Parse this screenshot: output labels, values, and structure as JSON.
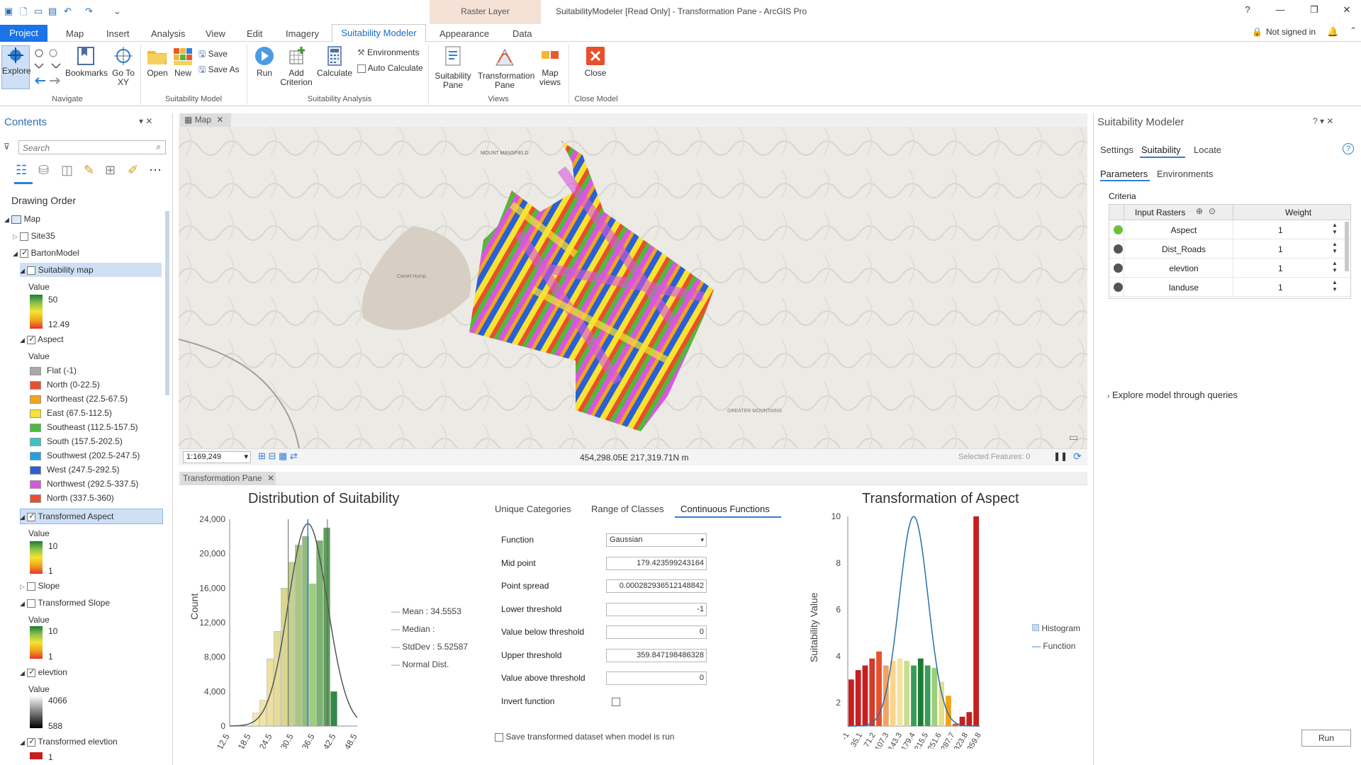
{
  "titlebar": {
    "context_tab": "Raster Layer",
    "title": "SuitabilityModeler [Read Only] - Transformation Pane - ArcGIS Pro",
    "help": "?"
  },
  "tabs": [
    "Project",
    "Map",
    "Insert",
    "Analysis",
    "View",
    "Edit",
    "Imagery",
    "Suitability Modeler",
    "Appearance",
    "Data"
  ],
  "signin": "Not signed in",
  "ribbon": {
    "navigate": {
      "explore": "Explore",
      "bookmarks": "Bookmarks",
      "goto": "Go To XY",
      "group": "Navigate"
    },
    "model": {
      "open": "Open",
      "new": "New",
      "save": "Save",
      "save_as": "Save As",
      "group": "Suitability Model"
    },
    "analysis": {
      "run": "Run",
      "add_criterion": "Add Criterion",
      "calculate": "Calculate",
      "environments": "Environments",
      "auto_calculate": "Auto Calculate",
      "group": "Suitability Analysis"
    },
    "views": {
      "suitability_pane": "Suitability Pane",
      "transformation_pane": "Transformation Pane",
      "map_views": "Map views",
      "group": "Views"
    },
    "close": {
      "close": "Close",
      "group": "Close Model"
    }
  },
  "contents": {
    "title": "Contents",
    "search_placeholder": "Search",
    "drawing_order": "Drawing Order",
    "map": "Map",
    "site": "Site35",
    "model": "BartonModel",
    "suit_map": "Suitability map",
    "value": "Value",
    "suit_high": "50",
    "suit_low": "12.49",
    "aspect": "Aspect",
    "aspect_classes": [
      {
        "label": "Flat (-1)",
        "color": "#a9a9a9"
      },
      {
        "label": "North (0-22.5)",
        "color": "#e8502c"
      },
      {
        "label": "Northeast (22.5-67.5)",
        "color": "#f0a51b"
      },
      {
        "label": "East (67.5-112.5)",
        "color": "#f7e332"
      },
      {
        "label": "Southeast (112.5-157.5)",
        "color": "#4dbb3c"
      },
      {
        "label": "South (157.5-202.5)",
        "color": "#3bc3c7"
      },
      {
        "label": "Southwest (202.5-247.5)",
        "color": "#1fa2e4"
      },
      {
        "label": "West (247.5-292.5)",
        "color": "#2a5fd6"
      },
      {
        "label": "Northwest (292.5-337.5)",
        "color": "#d957e0"
      },
      {
        "label": "North (337.5-360)",
        "color": "#e8502c"
      }
    ],
    "t_aspect": "Transformed Aspect",
    "t_aspect_high": "10",
    "t_aspect_low": "1",
    "slope": "Slope",
    "t_slope": "Transformed Slope",
    "t_slope_high": "10",
    "t_slope_low": "1",
    "elevation": "elevtion",
    "elev_high": "4066",
    "elev_low": "588",
    "t_elevation": "Transformed elevtion",
    "t_elev_low": "1"
  },
  "map": {
    "tab": "Map",
    "scale": "1:169,249",
    "coords": "454,298.05E 217,319.71N m",
    "selected": "Selected Features: 0",
    "labels": [
      "MOUNT MANSFIELD",
      "GREATER MOUNTAINS",
      "Camel Hump"
    ]
  },
  "transformation": {
    "tab": "Transformation Pane",
    "dist_title": "Distribution of Suitability",
    "dist_ylabel": "Count",
    "dist_yticks": [
      "24,000",
      "20,000",
      "16,000",
      "12,000",
      "8,000",
      "4,000",
      "0"
    ],
    "dist_xticks": [
      "12.5",
      "18.5",
      "24.5",
      "30.5",
      "36.5",
      "42.5",
      "48.5"
    ],
    "stats": {
      "mean": "Mean : 34.5553",
      "median": "Median :",
      "stddev": "StdDev : 5.52587",
      "normal": "Normal Dist."
    },
    "method_tabs": [
      "Unique Categories",
      "Range of Classes",
      "Continuous Functions"
    ],
    "fields": [
      {
        "label": "Function",
        "value": "Gaussian"
      },
      {
        "label": "Mid point",
        "value": "179.423599243164"
      },
      {
        "label": "Point spread",
        "value": "0.000282936512148842"
      },
      {
        "label": "Lower threshold",
        "value": "-1"
      },
      {
        "label": "Value below threshold",
        "value": "0"
      },
      {
        "label": "Upper threshold",
        "value": "359.847198486328"
      },
      {
        "label": "Value above threshold",
        "value": "0"
      },
      {
        "label": "Invert function",
        "value": ""
      }
    ],
    "save_checkbox": "Save transformed dataset when model is run",
    "trans_title": "Transformation of Aspect",
    "trans_ylabel": "Suitability Value",
    "trans_yticks": [
      "10",
      "8",
      "6",
      "4",
      "2"
    ],
    "trans_xticks": [
      "-1",
      "35.1",
      "71.2",
      "107.3",
      "143.3",
      "179.4",
      "215.5",
      "251.6",
      "287.7",
      "323.8",
      "359.8"
    ],
    "legend": {
      "histogram": "Histogram",
      "function": "Function"
    }
  },
  "chart_data": [
    {
      "type": "bar",
      "title": "Distribution of Suitability",
      "ylabel": "Count",
      "ylim": [
        0,
        24000
      ],
      "x": [
        20,
        22,
        24,
        26,
        28,
        30,
        32,
        34,
        36,
        38,
        40,
        42
      ],
      "values": [
        1500,
        3000,
        7800,
        11000,
        16000,
        19000,
        21000,
        22000,
        16500,
        21500,
        23000,
        4000
      ],
      "annotations": {
        "mean": 34.5553,
        "stddev": 5.52587
      }
    },
    {
      "type": "bar",
      "title": "Transformation of Aspect",
      "ylabel": "Suitability Value",
      "ylim": [
        1,
        10
      ],
      "values": [
        3.0,
        3.4,
        3.6,
        3.9,
        4.2,
        3.6,
        3.8,
        3.9,
        3.8,
        3.6,
        3.9,
        3.6,
        3.5,
        2.9,
        2.3,
        1.1,
        1.4,
        1.6,
        10.0
      ],
      "function": "Gaussian",
      "midpoint": 179.4
    }
  ],
  "right": {
    "title": "Suitability Modeler",
    "tabs": [
      "Settings",
      "Suitability",
      "Locate"
    ],
    "subtabs": [
      "Parameters",
      "Environments"
    ],
    "criteria": "Criteria",
    "col_input": "Input Rasters",
    "col_weight": "Weight",
    "rows": [
      {
        "name": "Aspect",
        "weight": "1",
        "color": "#6cc13a"
      },
      {
        "name": "Dist_Roads",
        "weight": "1",
        "color": "#555555"
      },
      {
        "name": "elevtion",
        "weight": "1",
        "color": "#555555"
      },
      {
        "name": "landuse",
        "weight": "1",
        "color": "#555555"
      }
    ],
    "explore": "Explore model through queries",
    "run": "Run"
  }
}
